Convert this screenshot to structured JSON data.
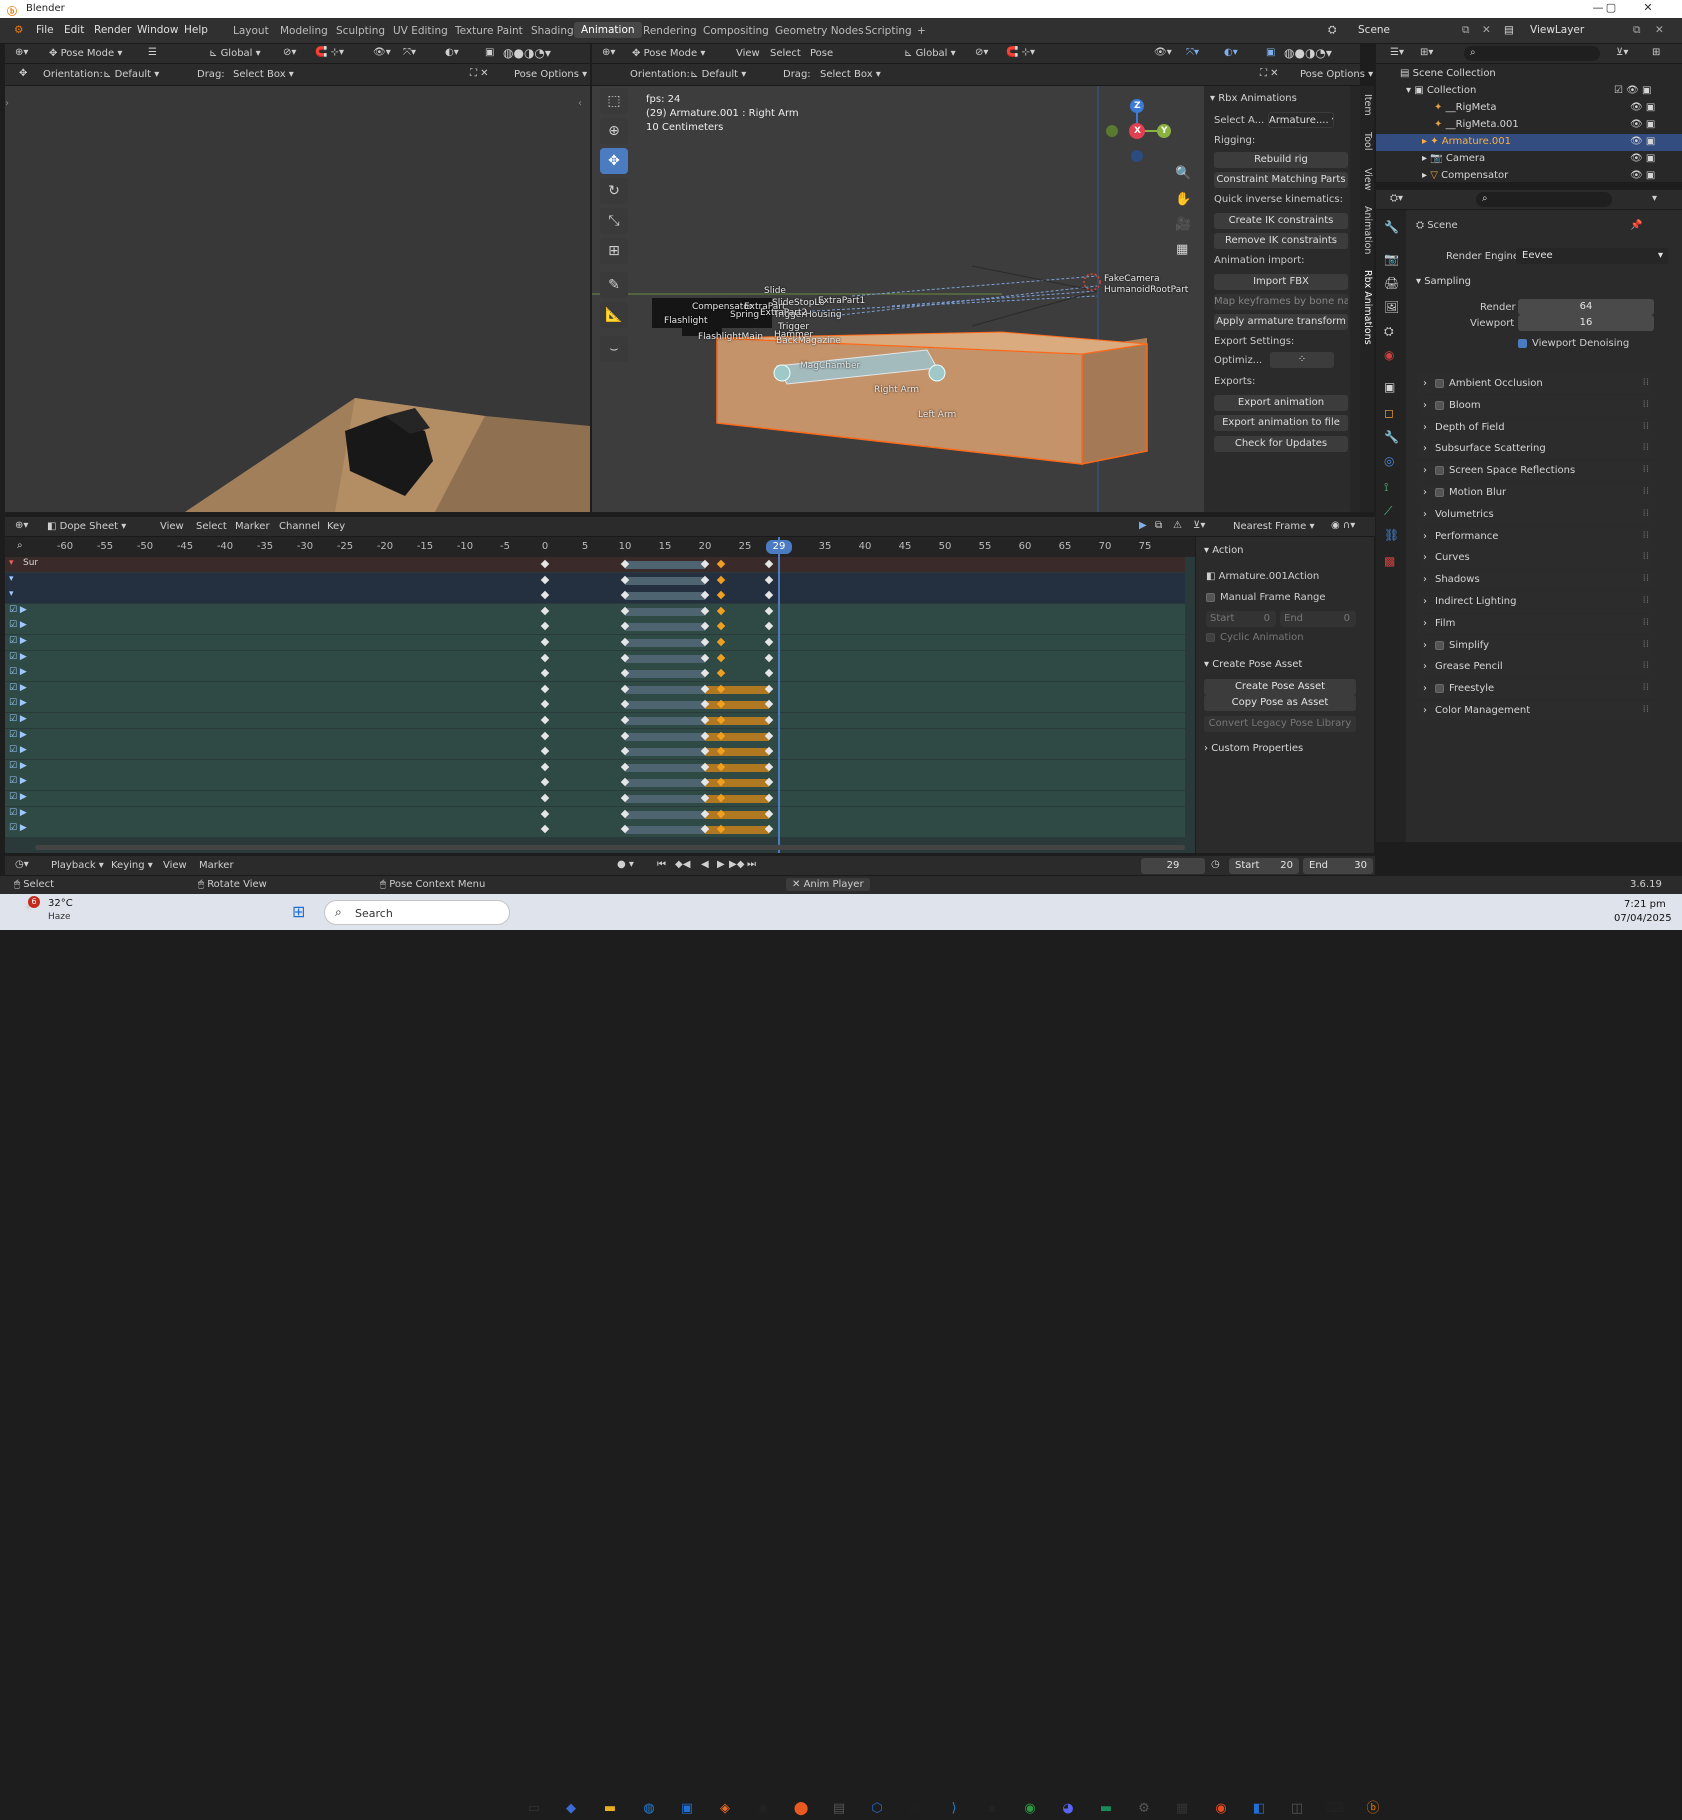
{
  "window": {
    "title": "Blender",
    "logo": "blender-icon"
  },
  "menu": {
    "file": "File",
    "edit": "Edit",
    "render": "Render",
    "window": "Window",
    "help": "Help"
  },
  "workspaces": [
    "Layout",
    "Modeling",
    "Sculpting",
    "UV Editing",
    "Texture Paint",
    "Shading",
    "Animation",
    "Rendering",
    "Compositing",
    "Geometry Nodes",
    "Scripting",
    "+"
  ],
  "active_workspace": "Animation",
  "scene": {
    "scene_name": "Scene",
    "view_layer": "ViewLayer"
  },
  "left_viewport": {
    "mode": "Pose Mode",
    "transform": "Global",
    "orientation_label": "Orientation:",
    "orientation_value": "Default",
    "drag_label": "Drag:",
    "drag_value": "Select Box",
    "pose_options": "Pose Options"
  },
  "main_viewport": {
    "mode": "Pose Mode",
    "menu_view": "View",
    "menu_select": "Select",
    "menu_pose": "Pose",
    "transform": "Global",
    "orientation_label": "Orientation:",
    "orientation_value": "Default",
    "drag_label": "Drag:",
    "drag_value": "Select Box",
    "pose_options": "Pose Options",
    "overlay_fps": "fps: 24",
    "overlay_object": "(29) Armature.001 : Right Arm",
    "overlay_scale": "10 Centimeters",
    "gizmo_axes": [
      "X",
      "Y",
      "Z"
    ],
    "bone_labels": [
      "Slide",
      "SlideStopLo",
      "ExtraPart1",
      "Compensator",
      "ExtraPart",
      "TriggerHousing",
      "Spring",
      "ExtraPart2",
      "Trigger",
      "Flashlight",
      "Hammer",
      "FlashlightMain",
      "BackMagazine",
      "MagChamber",
      "Right Arm",
      "Left Arm",
      "FakeCamera",
      "HumanoidRootPart"
    ]
  },
  "sidebar_tabs": [
    "Item",
    "Tool",
    "View",
    "Animation",
    "Rbx Animations"
  ],
  "rbx_panel": {
    "title": "Rbx Animations",
    "select_label": "Select A...",
    "select_value": "Armature....",
    "rigging_label": "Rigging:",
    "rebuild_rig": "Rebuild rig",
    "constraint_matching": "Constraint Matching Parts",
    "qik_label": "Quick inverse kinematics:",
    "create_ik": "Create IK constraints",
    "remove_ik": "Remove IK constraints",
    "anim_import_label": "Animation import:",
    "import_fbx": "Import FBX",
    "map_keyframes": "Map keyframes by bone name",
    "apply_armature": "Apply armature transform",
    "export_settings_label": "Export Settings:",
    "optimize_label": "Optimiz...",
    "exports_label": "Exports:",
    "export_animation": "Export animation",
    "export_to_file": "Export animation to file",
    "check_updates": "Check for Updates"
  },
  "outliner": {
    "root": "Scene Collection",
    "items": [
      {
        "name": "Collection",
        "level": 1
      },
      {
        "name": "__RigMeta",
        "level": 2
      },
      {
        "name": "__RigMeta.001",
        "level": 2
      },
      {
        "name": "Armature.001",
        "level": 2,
        "selected": true
      },
      {
        "name": "Camera",
        "level": 2
      },
      {
        "name": "Compensator",
        "level": 2
      }
    ]
  },
  "properties": {
    "scene_label": "Scene",
    "render_engine_label": "Render Engine",
    "render_engine_value": "Eevee",
    "sampling": "Sampling",
    "render_label": "Render",
    "render_value": "64",
    "viewport_label": "Viewport",
    "viewport_value": "16",
    "viewport_denoising": "Viewport Denoising",
    "sections": [
      "Ambient Occlusion",
      "Bloom",
      "Depth of Field",
      "Subsurface Scattering",
      "Screen Space Reflections",
      "Motion Blur",
      "Volumetrics",
      "Performance",
      "Curves",
      "Shadows",
      "Indirect Lighting",
      "Film",
      "Simplify",
      "Grease Pencil",
      "Freestyle",
      "Color Management"
    ]
  },
  "dopesheet": {
    "editor": "Dope Sheet",
    "menus": [
      "View",
      "Select",
      "Marker",
      "Channel",
      "Key"
    ],
    "snap_mode": "Nearest Frame",
    "ticks": [
      "-60",
      "-55",
      "-50",
      "-45",
      "-40",
      "-35",
      "-30",
      "-25",
      "-20",
      "-15",
      "-10",
      "-5",
      "0",
      "5",
      "10",
      "15",
      "20",
      "25",
      "30",
      "35",
      "40",
      "45",
      "50",
      "55",
      "60",
      "65",
      "70",
      "75"
    ],
    "current_frame": "29",
    "summary_label": "Sur"
  },
  "action_panel": {
    "action_header": "Action",
    "action_name": "Armature.001Action",
    "manual_frame_range": "Manual Frame Range",
    "start_label": "Start",
    "start_value": "0",
    "end_label": "End",
    "end_value": "0",
    "cyclic": "Cyclic Animation",
    "pose_asset_header": "Create Pose Asset",
    "create_pose_asset": "Create Pose Asset",
    "copy_pose": "Copy Pose as Asset",
    "convert_legacy": "Convert Legacy Pose Library",
    "custom_properties": "Custom Properties"
  },
  "timeline": {
    "playback": "Playback",
    "keying": "Keying",
    "view": "View",
    "marker": "Marker",
    "frame": "29",
    "start_label": "Start",
    "start_value": "20",
    "end_label": "End",
    "end_value": "30"
  },
  "statusbar": {
    "select": "Select",
    "rotate": "Rotate View",
    "context": "Pose Context Menu",
    "anim_player": "Anim Player",
    "version": "3.6.19"
  },
  "taskbar": {
    "weather_temp": "32°C",
    "weather_desc": "Haze",
    "weather_badge": "6",
    "search_placeholder": "Search",
    "time": "7:21 pm",
    "date": "07/04/2025"
  },
  "colors": {
    "accent": "#4b7cc2",
    "selection": "#f0a020",
    "bg": "#1d1d1d",
    "viewport_bg": "#3d3d3d"
  }
}
